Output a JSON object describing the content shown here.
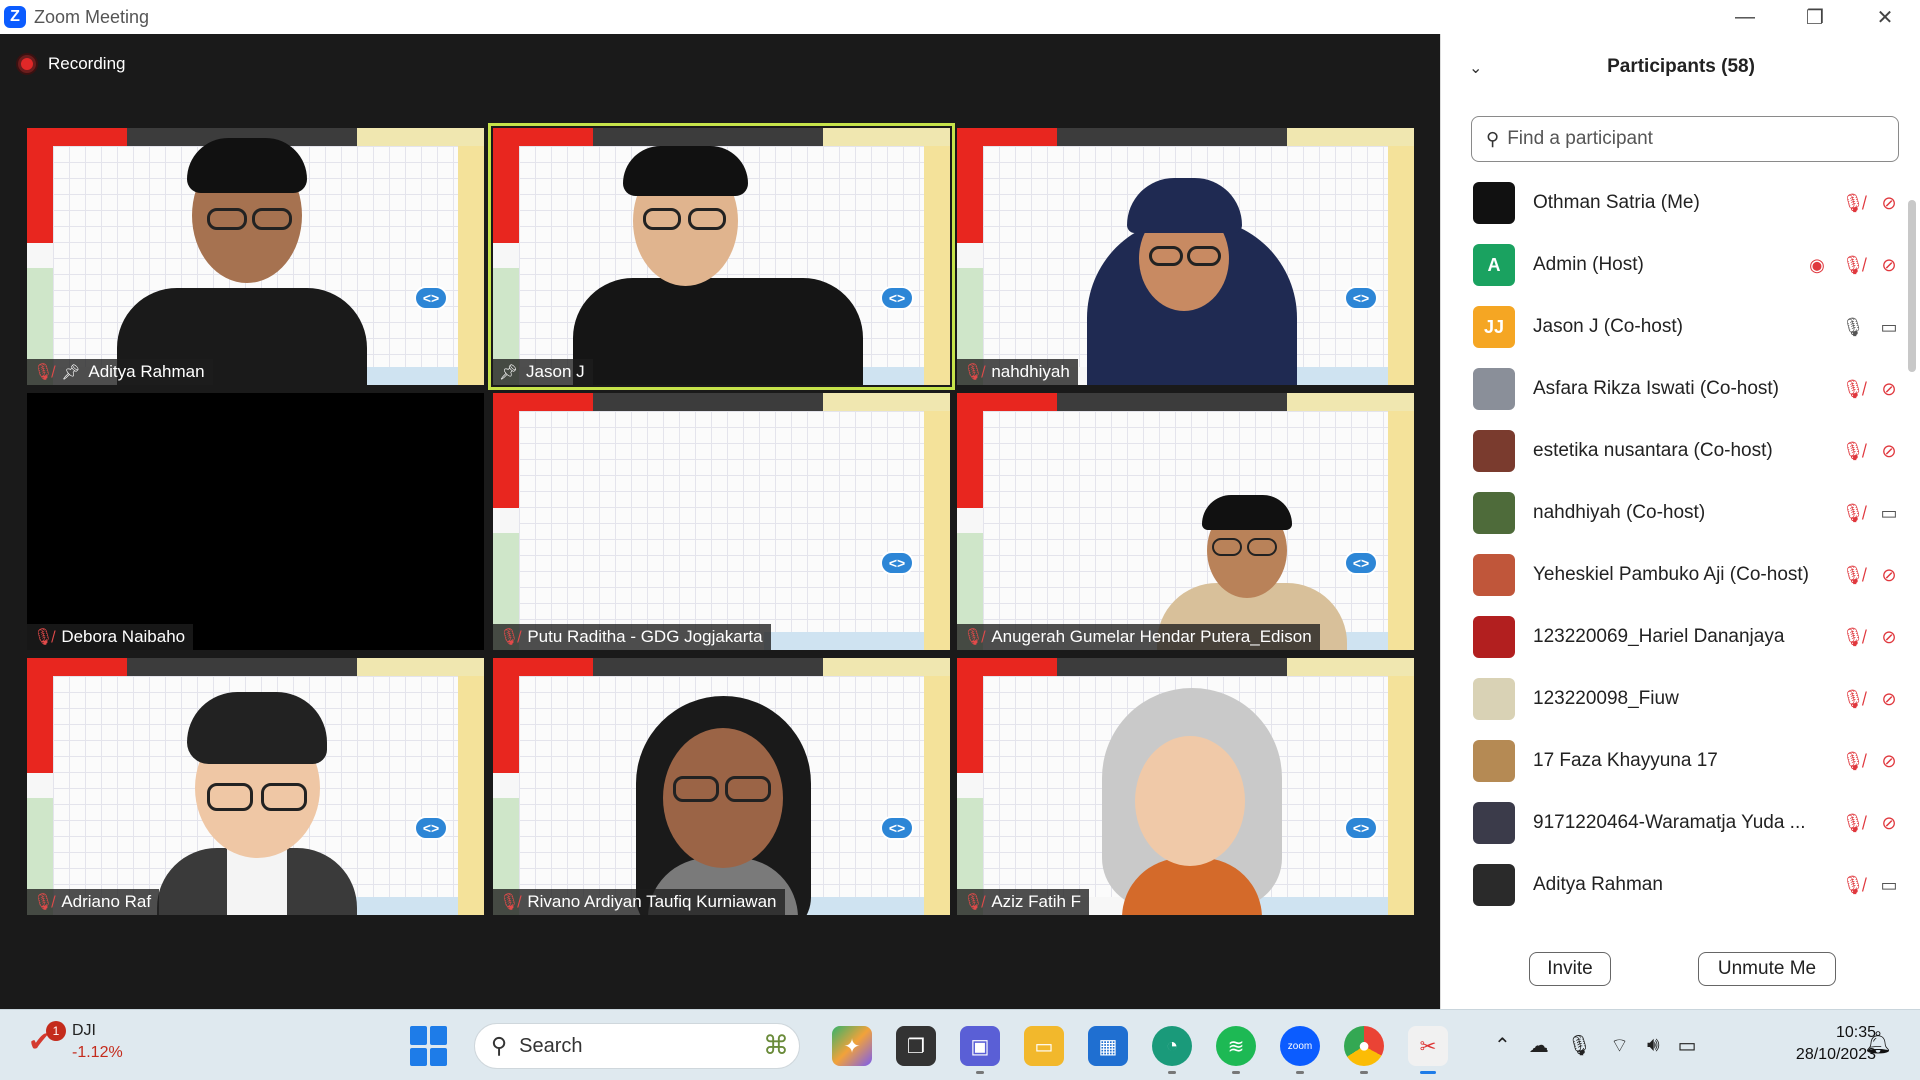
{
  "window": {
    "title": "Zoom Meeting",
    "minimize": "—",
    "restore": "❐",
    "close": "✕"
  },
  "meeting": {
    "recording_label": "Recording",
    "tiles": [
      {
        "name": "Aditya Rahman",
        "muted": true,
        "pinned": true
      },
      {
        "name": "Jason J",
        "muted": false,
        "pinned": true
      },
      {
        "name": "nahdhiyah",
        "muted": true,
        "pinned": false
      },
      {
        "name": "Debora Naibaho",
        "muted": true,
        "pinned": false
      },
      {
        "name": "Putu Raditha - GDG Jogjakarta",
        "muted": true,
        "pinned": false
      },
      {
        "name": "Anugerah Gumelar Hendar Putera_Edison",
        "muted": true,
        "pinned": false
      },
      {
        "name": "Adriano Raf",
        "muted": true,
        "pinned": false
      },
      {
        "name": "Rivano Ardiyan Taufiq Kurniawan",
        "muted": true,
        "pinned": false
      },
      {
        "name": "Aziz Fatih F",
        "muted": true,
        "pinned": false
      }
    ],
    "code_badge": "<>"
  },
  "participants": {
    "title": "Participants (58)",
    "search_placeholder": "Find a participant",
    "list": [
      {
        "name": "Othman Satria (Me)",
        "avatar_text": "",
        "avatar_color": "#111111",
        "recording": false,
        "mic": "muted",
        "video": "off"
      },
      {
        "name": "Admin (Host)",
        "avatar_text": "A",
        "avatar_color": "#1aa260",
        "recording": true,
        "mic": "muted",
        "video": "off"
      },
      {
        "name": "Jason J (Co-host)",
        "avatar_text": "JJ",
        "avatar_color": "#f5a623",
        "recording": false,
        "mic": "on",
        "video": "on"
      },
      {
        "name": "Asfara Rikza Iswati (Co-host)",
        "avatar_text": "",
        "avatar_color": "#8a8f99",
        "recording": false,
        "mic": "muted",
        "video": "off"
      },
      {
        "name": "estetika nusantara (Co-host)",
        "avatar_text": "",
        "avatar_color": "#7a3b2e",
        "recording": false,
        "mic": "muted",
        "video": "off"
      },
      {
        "name": "nahdhiyah (Co-host)",
        "avatar_text": "",
        "avatar_color": "#4e6b3a",
        "recording": false,
        "mic": "muted",
        "video": "on"
      },
      {
        "name": "Yeheskiel Pambuko Aji (Co-host)",
        "avatar_text": "",
        "avatar_color": "#c0563a",
        "recording": false,
        "mic": "muted",
        "video": "off"
      },
      {
        "name": "123220069_Hariel Dananjaya",
        "avatar_text": "",
        "avatar_color": "#b21f1f",
        "recording": false,
        "mic": "muted",
        "video": "off"
      },
      {
        "name": "123220098_Fiuw",
        "avatar_text": "",
        "avatar_color": "#d9d2b5",
        "recording": false,
        "mic": "muted",
        "video": "off"
      },
      {
        "name": "17 Faza Khayyuna 17",
        "avatar_text": "",
        "avatar_color": "#b58a54",
        "recording": false,
        "mic": "muted",
        "video": "off"
      },
      {
        "name": "9171220464-Waramatja Yuda ...",
        "avatar_text": "",
        "avatar_color": "#3b3b4a",
        "recording": false,
        "mic": "muted",
        "video": "off"
      },
      {
        "name": "Aditya Rahman",
        "avatar_text": "",
        "avatar_color": "#2a2a2a",
        "recording": false,
        "mic": "muted",
        "video": "on"
      }
    ],
    "invite_label": "Invite",
    "unmute_label": "Unmute Me"
  },
  "taskbar": {
    "stock_name": "DJI",
    "stock_change": "-1.12%",
    "notification_count": "1",
    "search_label": "Search",
    "time": "10:35",
    "date": "28/10/2023"
  }
}
